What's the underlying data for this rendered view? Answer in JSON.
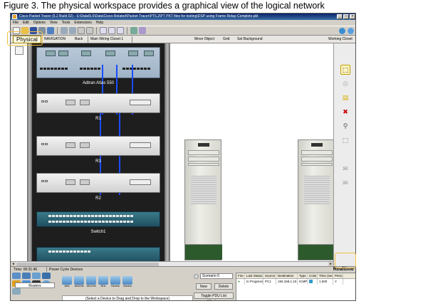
{
  "caption": "Figure 3. The physical workspace provides a graphical view of the logical network",
  "window": {
    "title": "Cisco Packet Tracer (5.2 Build 02) - S:\\Data\\5.0\\Data\\Cisco-Related\\Packet Tracer\\PT5.2\\PT PKT files for testing\\DSP using Frame Relay-Complete.pkt",
    "controls": [
      "_",
      "□",
      "×"
    ]
  },
  "menu": [
    "File",
    "Edit",
    "Options",
    "View",
    "Tools",
    "Extensions",
    "Help"
  ],
  "navbar": {
    "physical_tab": "Physical",
    "breadcrumb": [
      "NAVIGATION",
      "Back",
      "Main Wiring Closet 1"
    ],
    "actions": [
      "Move Object",
      "Grid",
      "Set Background"
    ],
    "location": "Working Closet"
  },
  "rack": {
    "labels": [
      "Adtran Atlas 550",
      "R1",
      "R3",
      "R2",
      "Switch1"
    ]
  },
  "right_tools": [
    {
      "icon": "select-icon",
      "glyph": "⬚"
    },
    {
      "icon": "move-icon",
      "glyph": "◎"
    },
    {
      "icon": "note-icon",
      "glyph": "▤"
    },
    {
      "icon": "delete-icon",
      "glyph": "✖"
    },
    {
      "icon": "inspect-icon",
      "glyph": "⚲"
    },
    {
      "icon": "resize-icon",
      "glyph": "⬚"
    },
    {
      "icon": "add-simple-pdu-icon",
      "glyph": "✉"
    },
    {
      "icon": "add-complex-pdu-icon",
      "glyph": "✉"
    }
  ],
  "status": {
    "time": "Time: 00:31:46",
    "power": "Power Cycle Devices",
    "mode": "Realtime"
  },
  "device_panel": {
    "category": "Routers",
    "devices": [
      "1841",
      "2620XM",
      "2621XM",
      "2811",
      "Generic",
      "Generic"
    ],
    "hint": "(Select a Device to Drag and Drop to the Workspace)"
  },
  "scenario": {
    "select": "Scenario 0",
    "new": "New",
    "delete": "Delete",
    "toggle": "Toggle PDU List Window"
  },
  "pdu_table": {
    "headers": [
      "Fire",
      "Last Status",
      "Source",
      "Destination",
      "Type",
      "Color",
      "Time (sec)",
      "Perio"
    ],
    "rows": [
      {
        "fire": "●",
        "status": "In Progress",
        "source": "PC1",
        "destination": "192.168.1.10",
        "type": "ICMP",
        "color": "#3399cc",
        "time": "1.000",
        "periodic": "Y"
      }
    ]
  },
  "colors": {
    "titlebar": "#0a246a",
    "cable": "#1a4cff",
    "switch": "#2d6a7a",
    "callout": "#f0c040"
  }
}
